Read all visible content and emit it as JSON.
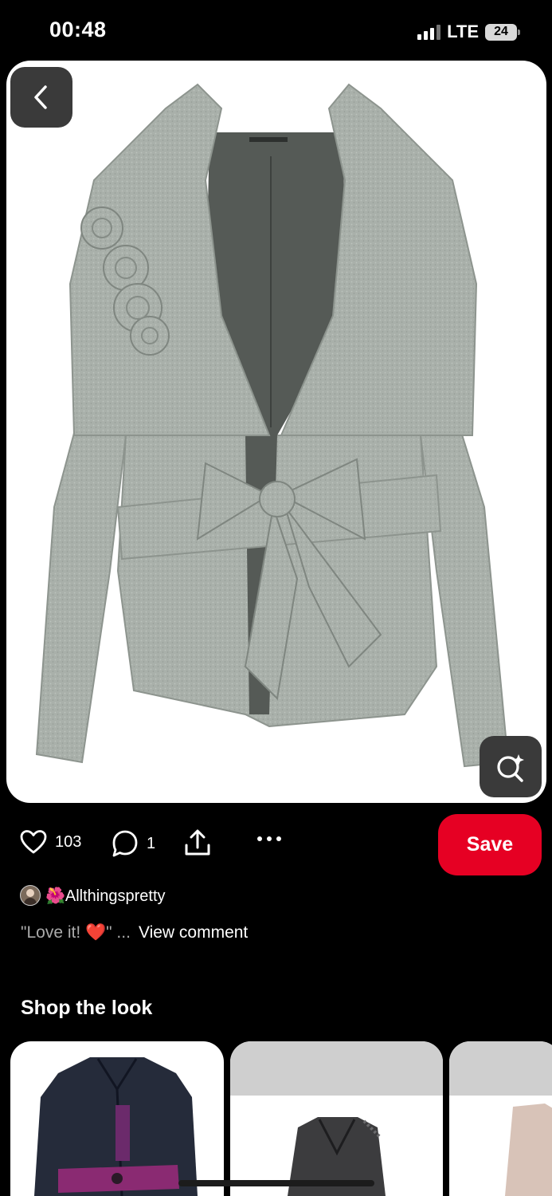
{
  "status_bar": {
    "time": "00:48",
    "network": "LTE",
    "battery": "24"
  },
  "pin": {
    "image_alt": "grey wool wrap jacket with rosette and bow belt",
    "back_icon": "chevron-left-icon",
    "visual_search_icon": "sparkle-search-icon"
  },
  "actions": {
    "like_count": "103",
    "comment_count": "1",
    "save_label": "Save"
  },
  "comment_preview": {
    "username": "🌺Allthingspretty",
    "text": "\"Love it! ❤️\" ...",
    "view_label": "View comment"
  },
  "shop": {
    "title": "Shop the look"
  },
  "colors": {
    "accent": "#e60023",
    "background": "#000000",
    "button_dark": "#3a3a3a"
  }
}
